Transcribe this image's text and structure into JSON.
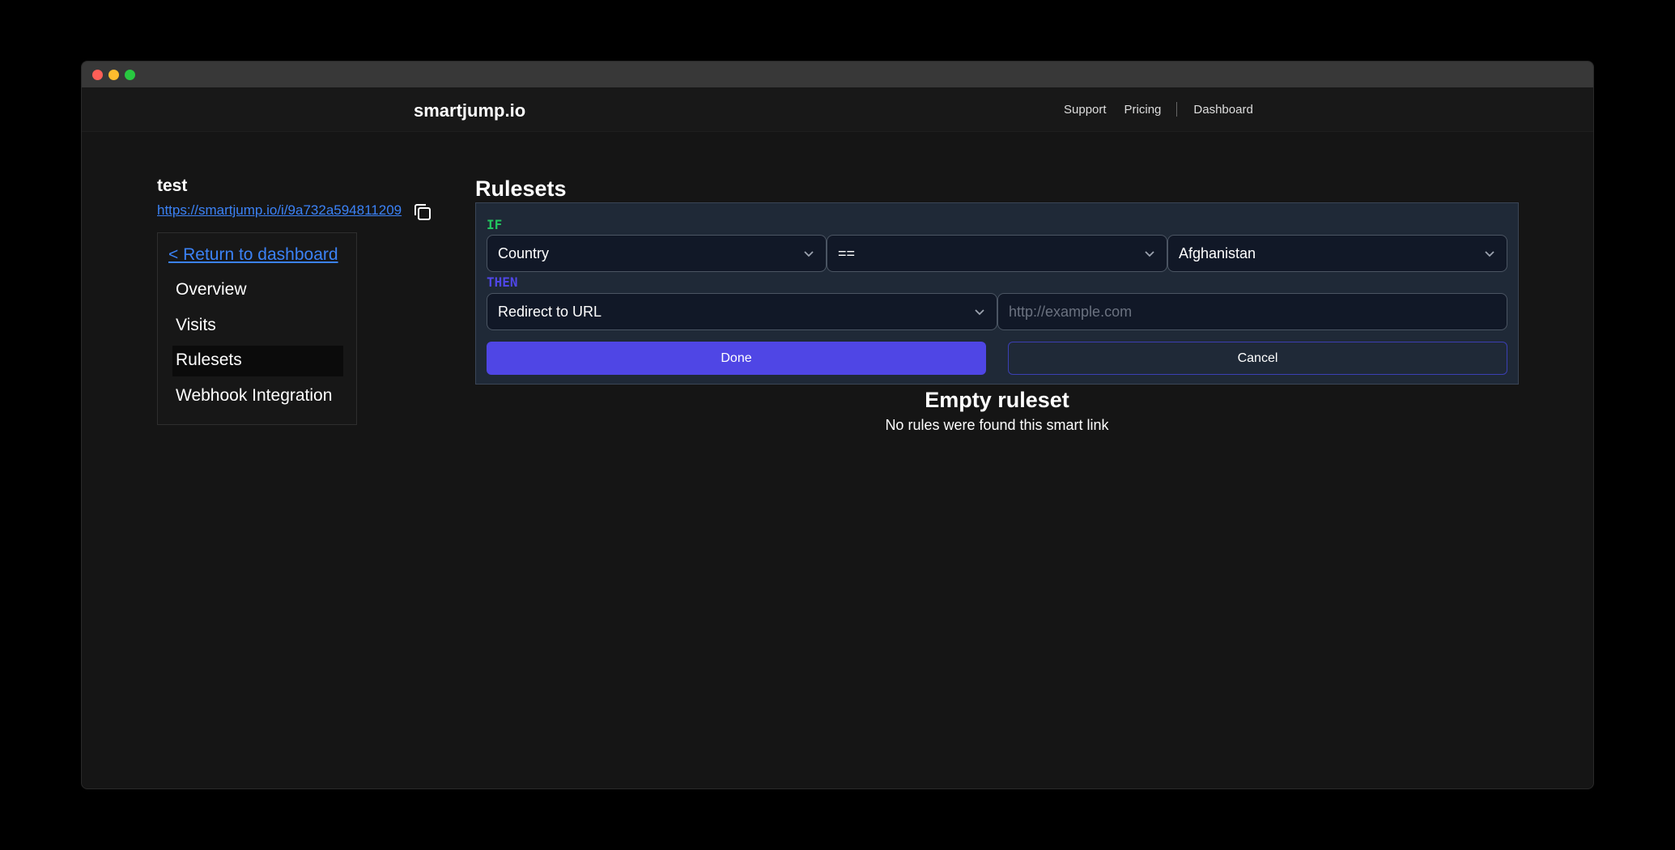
{
  "window": {
    "traffic_lights": [
      "close",
      "minimize",
      "zoom"
    ]
  },
  "navbar": {
    "brand": "smartjump.io",
    "links": {
      "support": "Support",
      "pricing": "Pricing",
      "dashboard": "Dashboard"
    }
  },
  "link": {
    "title": "test",
    "url": "https://smartjump.io/i/9a732a594811209",
    "copy_icon": "copy-icon"
  },
  "sidebar": {
    "back_label": "< Return to dashboard",
    "items": [
      {
        "label": "Overview",
        "active": false
      },
      {
        "label": "Visits",
        "active": false
      },
      {
        "label": "Rulesets",
        "active": true
      },
      {
        "label": "Webhook Integration",
        "active": false
      }
    ]
  },
  "main": {
    "title": "Rulesets",
    "rule": {
      "if_keyword": "IF",
      "then_keyword": "THEN",
      "condition_field": "Country",
      "condition_operator": "==",
      "condition_value": "Afghanistan",
      "action": "Redirect to URL",
      "url_value": "",
      "url_placeholder": "http://example.com",
      "done_label": "Done",
      "cancel_label": "Cancel"
    },
    "empty": {
      "title": "Empty ruleset",
      "subtitle": "No rules were found this smart link"
    }
  },
  "colors": {
    "accent": "#4f46e5",
    "if_keyword": "#22c55e",
    "link": "#3b82f6",
    "card_bg": "#1f2937"
  }
}
